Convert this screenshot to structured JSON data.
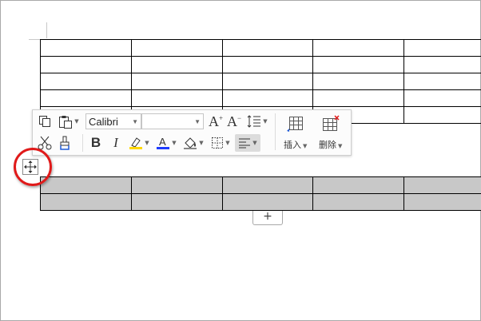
{
  "toolbar": {
    "font_name": "Calibri",
    "font_size": "",
    "insert_label": "插入",
    "delete_label": "删除"
  },
  "table_top": {
    "rows": 5,
    "cols": 5,
    "partial_last_col_rows": 1
  },
  "table_bottom": {
    "rows": 2,
    "cols": 5,
    "selected": true
  },
  "add_row_symbol": "+",
  "colors": {
    "selection_fill": "#c8c8c8",
    "highlight_ring": "#e01a1a",
    "highlighter_yellow": "#ffd800",
    "font_color_blue": "#1f3cff"
  },
  "icons": [
    "copy-icon",
    "paste-icon",
    "cut-icon",
    "format-painter-icon",
    "grow-font-icon",
    "shrink-font-icon",
    "line-spacing-icon",
    "bold-icon",
    "italic-icon",
    "highlight-icon",
    "font-color-icon",
    "shading-icon",
    "borders-icon",
    "align-icon",
    "insert-table-icon",
    "delete-table-icon",
    "table-move-icon"
  ]
}
